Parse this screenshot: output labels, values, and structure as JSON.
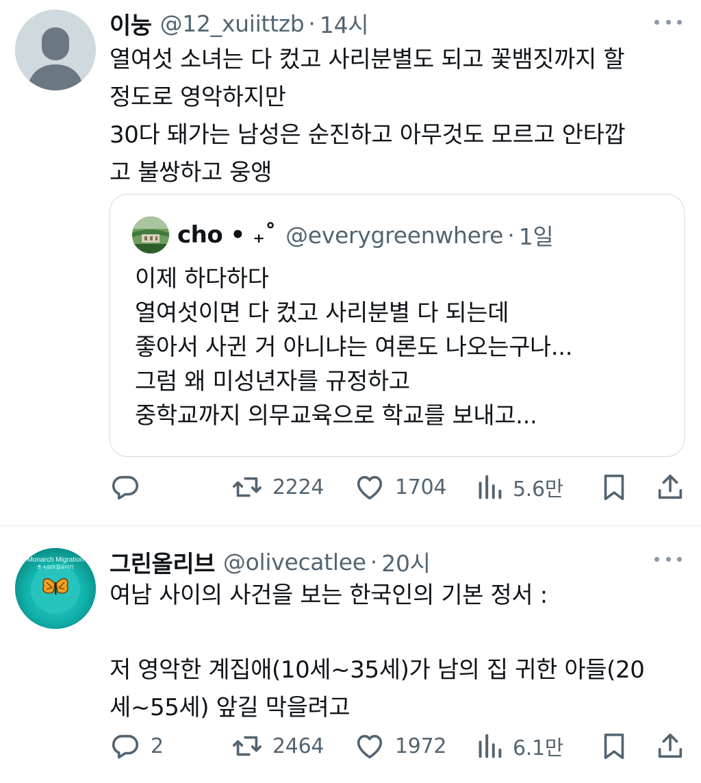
{
  "tweets": [
    {
      "author_name": "이눙",
      "handle": "@12_xuiittzb",
      "separator": "·",
      "time": "14시",
      "avatar_icon": "default-profile-icon",
      "text_lines": [
        "열여섯 소녀는 다 컸고 사리분별도 되고 꽃뱀짓까지 할",
        "정도로 영악하지만",
        "30다 돼가는 남성은 순진하고 아무것도 모르고 안타깝",
        "고 불쌍하고 웅앵"
      ],
      "quoted": {
        "author_name": "cho • ₊˚",
        "handle": "@everygreenwhere",
        "separator": "·",
        "time": "1일",
        "text_lines": [
          "이제 하다하다",
          "열여섯이면 다 컸고 사리분별 다 되는데",
          "좋아서 사귄 거 아니냐는 여론도 나오는구나...",
          "그럼 왜 미성년자를 규정하고",
          "중학교까지 의무교육으로 학교를 보내고..."
        ]
      },
      "actions": {
        "reply_count": "",
        "retweet_count": "2224",
        "like_count": "1704",
        "views_count": "5.6만"
      }
    },
    {
      "author_name": "그린올리브",
      "handle": "@olivecatlee",
      "separator": "·",
      "time": "20시",
      "avatar_text_line1": "Monarch Migration",
      "avatar_text_line2": "총 4,023 킬로미터",
      "text_lines": [
        "여남 사이의 사건을 보는 한국인의 기본 정서 :",
        "",
        "저 영악한 계집애(10세~35세)가 남의 집 귀한 아들(20",
        "세~55세) 앞길 막을려고"
      ],
      "actions": {
        "reply_count": "2",
        "retweet_count": "2464",
        "like_count": "1972",
        "views_count": "6.1만"
      }
    }
  ],
  "colors": {
    "text": "#0f1419",
    "secondary": "#536471",
    "border": "#cfd9de",
    "avatar_default": "#cfd9de",
    "avatar_teal": "#12b2ad"
  }
}
